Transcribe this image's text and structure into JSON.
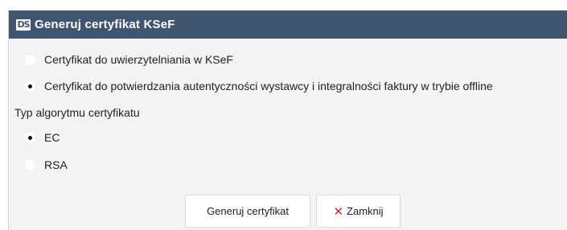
{
  "dialog": {
    "logo_text": "DS",
    "title": "Generuj certyfikat KSeF"
  },
  "certificate_type": {
    "options": [
      {
        "label": "Certyfikat do uwierzytelniania w KSeF",
        "selected": false
      },
      {
        "label": "Certyfikat do potwierdzania autentyczności wystawcy i integralności faktury w trybie offline",
        "selected": true
      }
    ]
  },
  "algorithm": {
    "label": "Typ algorytmu certyfikatu",
    "options": [
      {
        "label": "EC",
        "selected": true
      },
      {
        "label": "RSA",
        "selected": false
      }
    ]
  },
  "buttons": {
    "generate_label": "Generuj certyfikat",
    "close_label": "Zamknij",
    "close_icon": "✕"
  },
  "colors": {
    "titlebar": "#3f5570",
    "close_icon": "#e02020"
  }
}
